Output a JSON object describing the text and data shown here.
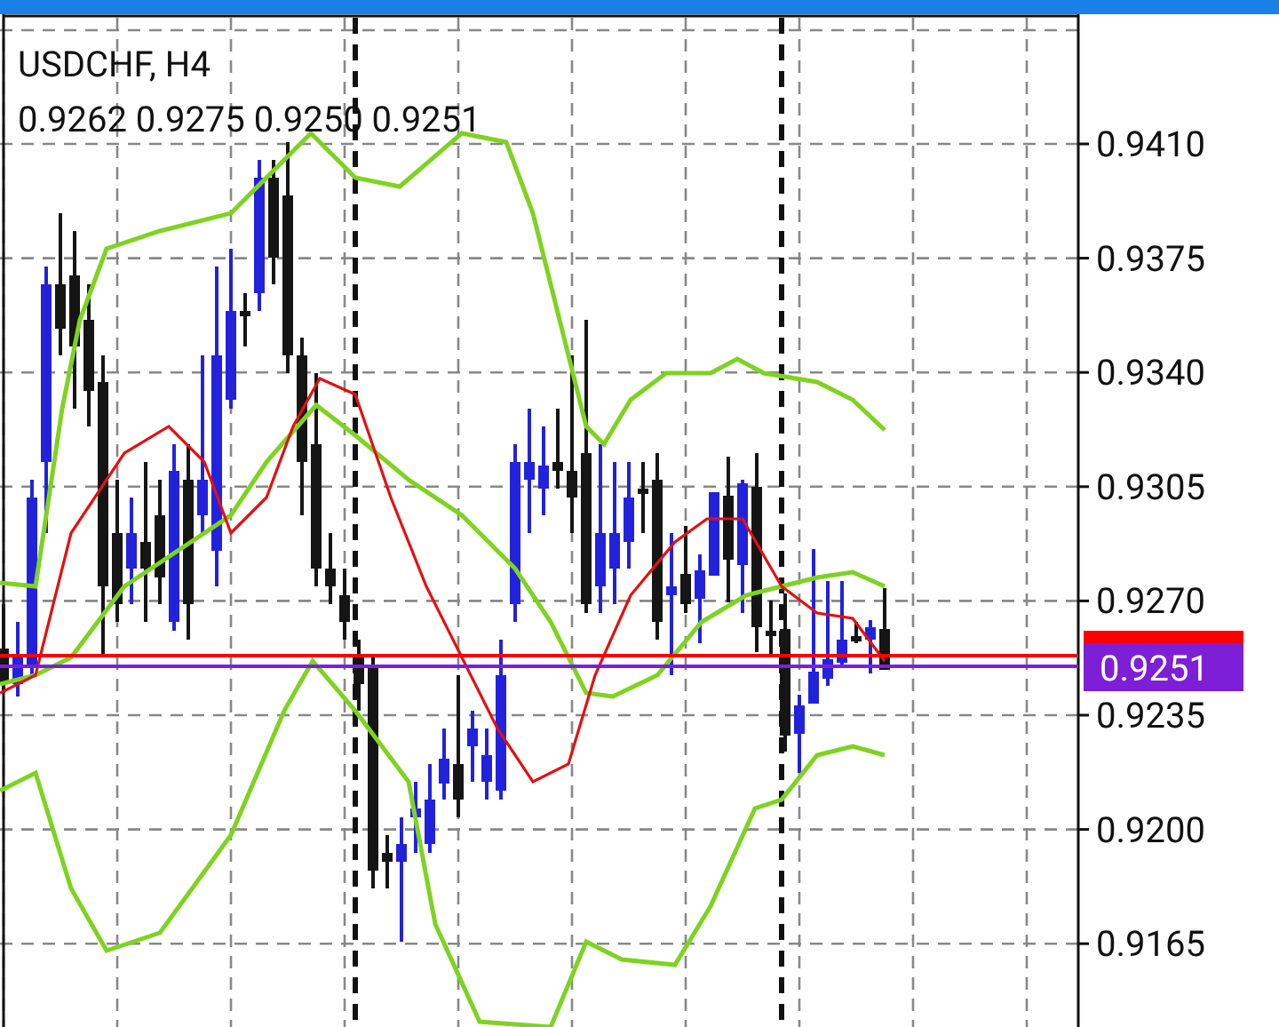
{
  "chart": {
    "symbol": "USDCHF, H4",
    "ohlc": "0.9262 0.9275 0.9250 0.9251",
    "price_scale": [
      "0.9410",
      "0.9375",
      "0.9340",
      "0.9305",
      "0.9270",
      "0.9235",
      "0.9200",
      "0.9165"
    ],
    "current_price": "0.9251"
  }
}
